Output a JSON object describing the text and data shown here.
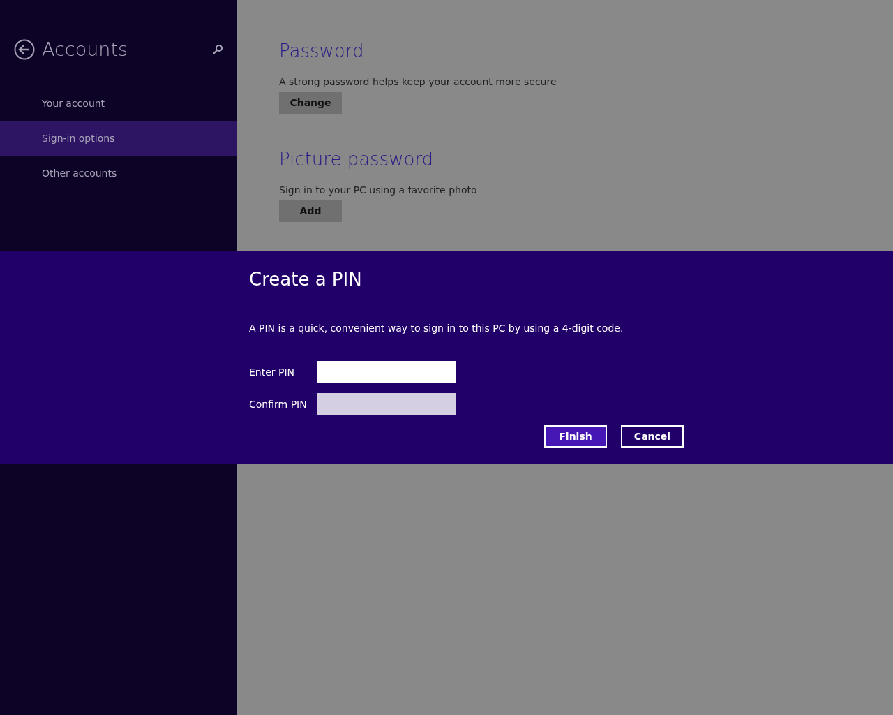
{
  "sidebar": {
    "title": "Accounts",
    "items": [
      {
        "label": "Your account",
        "selected": false
      },
      {
        "label": "Sign-in options",
        "selected": true
      },
      {
        "label": "Other accounts",
        "selected": false
      }
    ]
  },
  "sections": [
    {
      "title": "Password",
      "description": "A strong password helps keep your account more secure",
      "button": "Change"
    },
    {
      "title": "Picture password",
      "description": "Sign in to your PC using a favorite photo",
      "button": "Add"
    }
  ],
  "dialog": {
    "title": "Create a PIN",
    "description": "A PIN is a quick, convenient way to sign in to this PC by using a 4-digit code.",
    "fields": [
      {
        "label": "Enter PIN",
        "disabled": false
      },
      {
        "label": "Confirm PIN",
        "disabled": true
      }
    ],
    "buttons": [
      {
        "label": "Finish",
        "default": true
      },
      {
        "label": "Cancel",
        "default": false
      }
    ]
  }
}
